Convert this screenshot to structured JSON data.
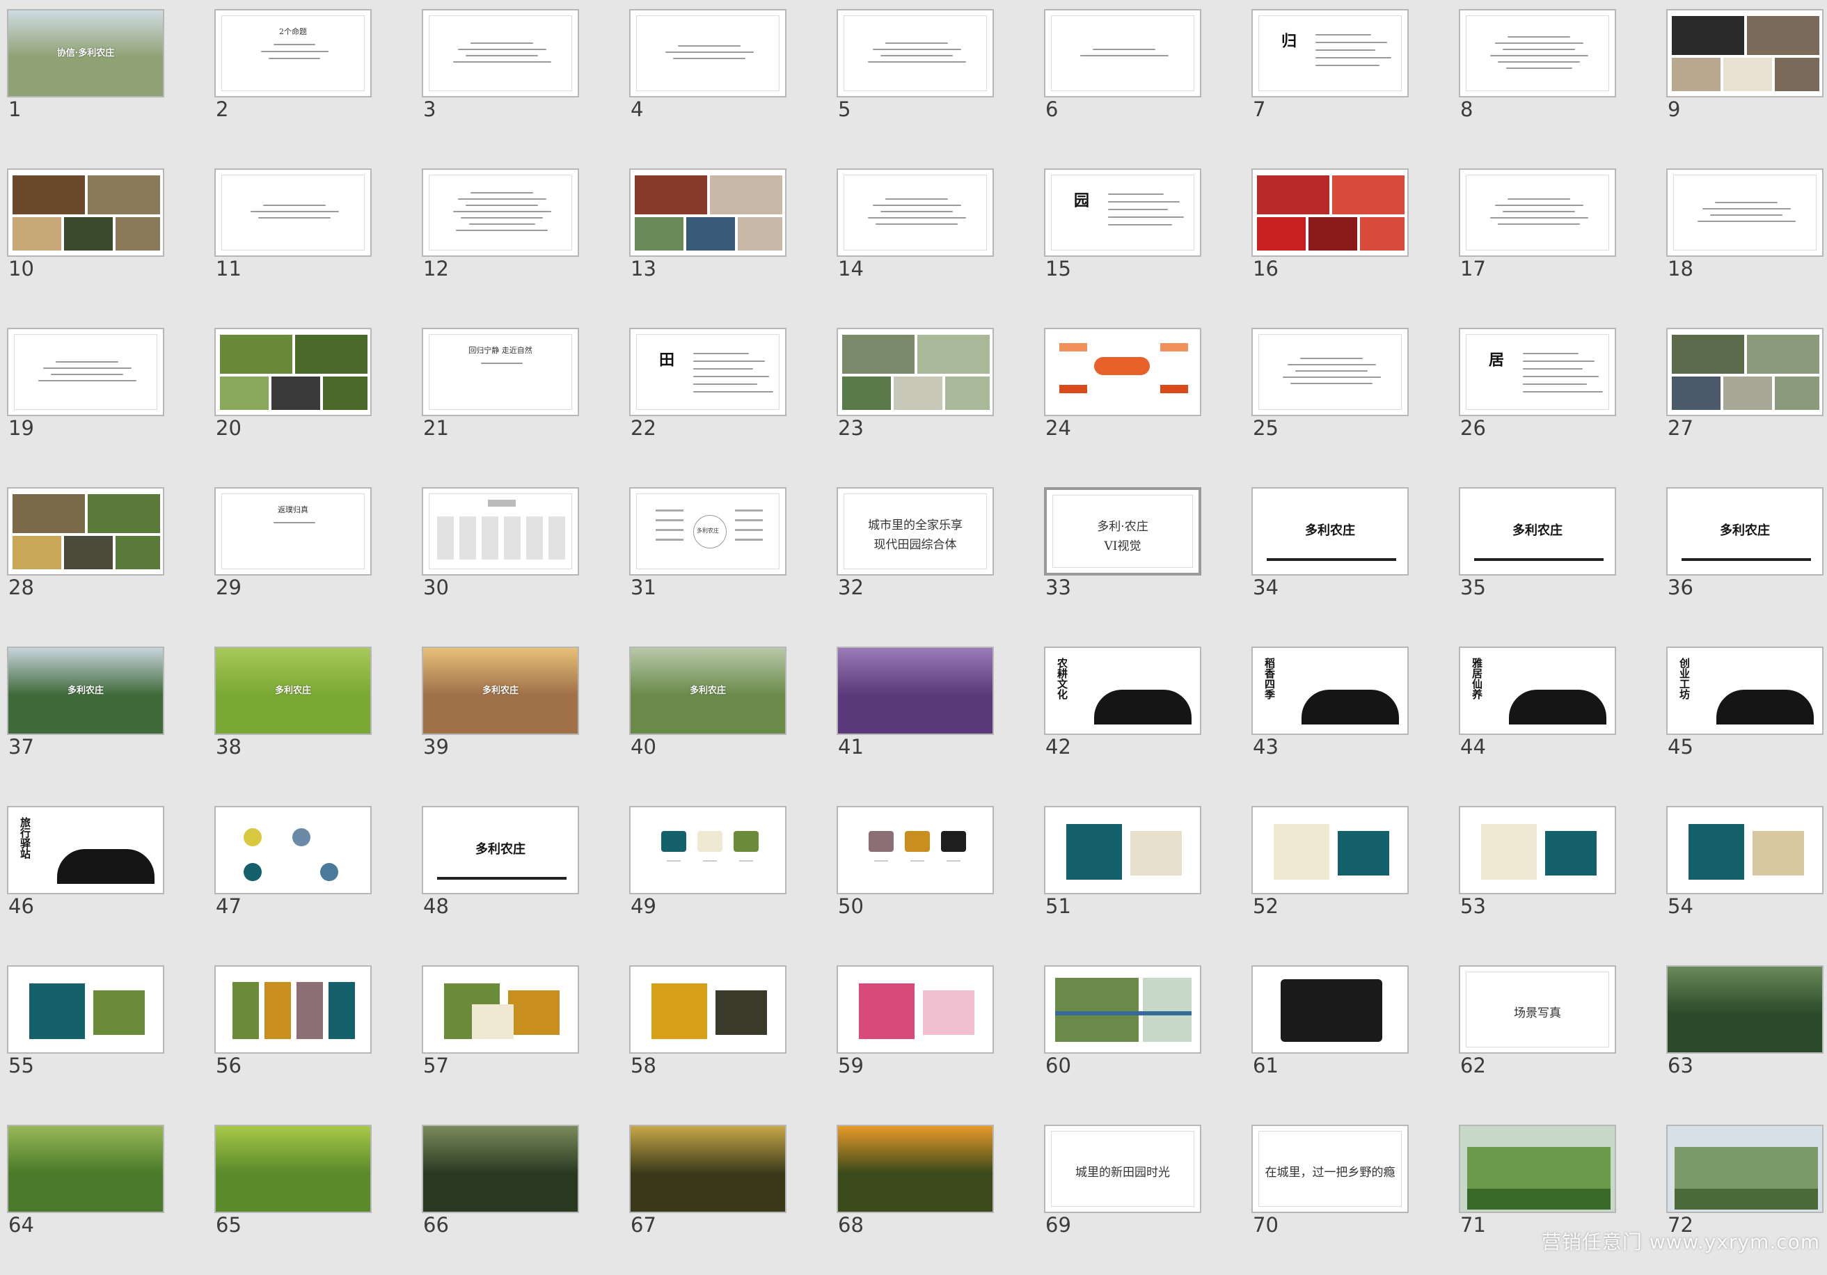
{
  "app": {
    "view": "slide-sorter"
  },
  "colors": {
    "background": "#e6e6e6",
    "thumb_border": "#b7b7b7",
    "selected_border": "#9a9a9a",
    "number_text": "#3c3c3c",
    "brand_teal": "#15616b",
    "brand_cream": "#efe9d4",
    "brand_olive": "#6b8b3a",
    "brand_mauve": "#8c6f74",
    "brand_gold": "#c98f1e",
    "brand_black": "#1e1e1e"
  },
  "selected_slide": "33",
  "watermark": "营销任意门 www.yxrym.com",
  "slides": [
    {
      "n": "1",
      "kind": "photo",
      "bg": "#8fa274",
      "accent": "#cfdbe2",
      "title": "协信·多利农庄"
    },
    {
      "n": "2",
      "kind": "title",
      "title": "2个命题",
      "lines": 3
    },
    {
      "n": "3",
      "kind": "text",
      "lines": 4
    },
    {
      "n": "4",
      "kind": "text",
      "lines": 3
    },
    {
      "n": "5",
      "kind": "text",
      "lines": 4
    },
    {
      "n": "6",
      "kind": "text",
      "lines": 2
    },
    {
      "n": "7",
      "kind": "vchar",
      "char": "归",
      "lines": 5
    },
    {
      "n": "8",
      "kind": "text",
      "lines": 6
    },
    {
      "n": "9",
      "kind": "collage",
      "colors": [
        "#2a2a2a",
        "#7a6a5a",
        "#b8a890",
        "#e8e0d0"
      ]
    },
    {
      "n": "10",
      "kind": "collage",
      "colors": [
        "#6a4a2a",
        "#8a7a5a",
        "#c8a878",
        "#3a4a2a"
      ]
    },
    {
      "n": "11",
      "kind": "text",
      "lines": 3
    },
    {
      "n": "12",
      "kind": "text",
      "lines": 7
    },
    {
      "n": "13",
      "kind": "collage",
      "colors": [
        "#8a3a2a",
        "#c8b8a8",
        "#6a8a5a",
        "#3a5a7a"
      ]
    },
    {
      "n": "14",
      "kind": "text",
      "lines": 5
    },
    {
      "n": "15",
      "kind": "vchar",
      "char": "园",
      "lines": 5
    },
    {
      "n": "16",
      "kind": "collage",
      "colors": [
        "#b82a2a",
        "#d84a3a",
        "#c82020",
        "#8a1a1a"
      ]
    },
    {
      "n": "17",
      "kind": "text",
      "lines": 5
    },
    {
      "n": "18",
      "kind": "text",
      "lines": 4
    },
    {
      "n": "19",
      "kind": "text",
      "lines": 4
    },
    {
      "n": "20",
      "kind": "collage",
      "colors": [
        "#6a8a3a",
        "#4a6a2a",
        "#8aa85a",
        "#3a3a3a"
      ]
    },
    {
      "n": "21",
      "kind": "title",
      "title": "回归宁静 走近自然",
      "lines": 1
    },
    {
      "n": "22",
      "kind": "vchar",
      "char": "田",
      "lines": 6
    },
    {
      "n": "23",
      "kind": "collage",
      "colors": [
        "#7a8a6a",
        "#aab89a",
        "#5a7a4a",
        "#c8c8b8"
      ]
    },
    {
      "n": "24",
      "kind": "diagram",
      "colors": [
        "#e8602a",
        "#f0905a",
        "#d84a1a"
      ]
    },
    {
      "n": "25",
      "kind": "text",
      "lines": 5
    },
    {
      "n": "26",
      "kind": "vchar",
      "char": "居",
      "lines": 6
    },
    {
      "n": "27",
      "kind": "collage",
      "colors": [
        "#5a6a4a",
        "#8a9a7a",
        "#4a5a6a",
        "#a8a898"
      ]
    },
    {
      "n": "28",
      "kind": "collage",
      "colors": [
        "#7a6a4a",
        "#5a7a3a",
        "#c8a858",
        "#4a4a3a"
      ]
    },
    {
      "n": "29",
      "kind": "title",
      "title": "返璞归真",
      "lines": 1
    },
    {
      "n": "30",
      "kind": "orgchart"
    },
    {
      "n": "31",
      "kind": "mindmap",
      "center": "多利农庄"
    },
    {
      "n": "32",
      "kind": "title2",
      "sub": "",
      "l1": "城市里的全家乐享",
      "l2": "现代田园综合体"
    },
    {
      "n": "33",
      "kind": "title2",
      "sub": "",
      "l1": "多利·农庄",
      "l2": "VI视觉"
    },
    {
      "n": "34",
      "kind": "logo",
      "logo": "多利农庄"
    },
    {
      "n": "35",
      "kind": "logo",
      "logo": "多利农庄"
    },
    {
      "n": "36",
      "kind": "logo",
      "logo": "多利农庄"
    },
    {
      "n": "37",
      "kind": "photo",
      "bg": "#3f6a3a",
      "accent": "#c8d4dc",
      "title": "多利农庄"
    },
    {
      "n": "38",
      "kind": "photo",
      "bg": "#7aa834",
      "accent": "#a8c85a",
      "title": "多利农庄"
    },
    {
      "n": "39",
      "kind": "photo",
      "bg": "#a07048",
      "accent": "#e8c078",
      "title": "多利农庄"
    },
    {
      "n": "40",
      "kind": "photo",
      "bg": "#6a8a4a",
      "accent": "#b8c8a8",
      "title": "多利农庄"
    },
    {
      "n": "41",
      "kind": "photo",
      "bg": "#5a3a7a",
      "accent": "#9a7ab8",
      "title": ""
    },
    {
      "n": "42",
      "kind": "ink",
      "char": "农耕文化"
    },
    {
      "n": "43",
      "kind": "ink",
      "char": "稻香四季"
    },
    {
      "n": "44",
      "kind": "ink",
      "char": "雅居仙养"
    },
    {
      "n": "45",
      "kind": "ink",
      "char": "创业工坊"
    },
    {
      "n": "46",
      "kind": "ink",
      "char": "旅行驿站"
    },
    {
      "n": "47",
      "kind": "icons"
    },
    {
      "n": "48",
      "kind": "logo",
      "logo": "多利农庄"
    },
    {
      "n": "49",
      "kind": "swatch",
      "colors": [
        "#15616b",
        "#efe9d4",
        "#6b8b3a"
      ]
    },
    {
      "n": "50",
      "kind": "swatch",
      "colors": [
        "#8c6f74",
        "#c98f1e",
        "#1e1e1e"
      ]
    },
    {
      "n": "51",
      "kind": "mock",
      "colors": [
        "#15616b",
        "#e8e0cc"
      ]
    },
    {
      "n": "52",
      "kind": "mock",
      "colors": [
        "#efe9d4",
        "#15616b"
      ]
    },
    {
      "n": "53",
      "kind": "mock",
      "colors": [
        "#efe9d4",
        "#15616b"
      ]
    },
    {
      "n": "54",
      "kind": "mock",
      "colors": [
        "#15616b",
        "#d8c8a0"
      ]
    },
    {
      "n": "55",
      "kind": "mock",
      "colors": [
        "#15616b",
        "#6b8b3a"
      ]
    },
    {
      "n": "56",
      "kind": "mock",
      "colors": [
        "#6b8b3a",
        "#c98f1e",
        "#8c6f74",
        "#15616b"
      ]
    },
    {
      "n": "57",
      "kind": "mock",
      "colors": [
        "#6b8b3a",
        "#c98f1e",
        "#efe9d4"
      ]
    },
    {
      "n": "58",
      "kind": "mock",
      "colors": [
        "#d8a018",
        "#3a3a2a"
      ]
    },
    {
      "n": "59",
      "kind": "mock",
      "colors": [
        "#d84a7a",
        "#f0c0d0"
      ]
    },
    {
      "n": "60",
      "kind": "map",
      "colors": [
        "#6a8a4a",
        "#c8d8c8",
        "#3a6a9a"
      ]
    },
    {
      "n": "61",
      "kind": "leather",
      "colors": [
        "#1a1a1a"
      ]
    },
    {
      "n": "62",
      "kind": "title2",
      "sub": "",
      "l1": "场景写真",
      "l2": ""
    },
    {
      "n": "63",
      "kind": "photo",
      "bg": "#2a4a2a",
      "accent": "#6a8a5a",
      "title": ""
    },
    {
      "n": "64",
      "kind": "photo",
      "bg": "#4a7a2a",
      "accent": "#98b858",
      "title": ""
    },
    {
      "n": "65",
      "kind": "photo",
      "bg": "#5a8a2a",
      "accent": "#a8c848",
      "title": ""
    },
    {
      "n": "66",
      "kind": "photo",
      "bg": "#2a3a22",
      "accent": "#7a8a5a",
      "title": ""
    },
    {
      "n": "67",
      "kind": "photo",
      "bg": "#3a3a1a",
      "accent": "#c8a848",
      "title": ""
    },
    {
      "n": "68",
      "kind": "photo",
      "bg": "#3a4a1a",
      "accent": "#e89a2a",
      "title": ""
    },
    {
      "n": "69",
      "kind": "title2",
      "sub": "",
      "l1": "城里的新田园时光",
      "l2": ""
    },
    {
      "n": "70",
      "kind": "title2",
      "sub": "",
      "l1": "在城里，过一把乡野的瘾",
      "l2": ""
    },
    {
      "n": "71",
      "kind": "billboard",
      "colors": [
        "#6a9a4a",
        "#c8d8c8",
        "#3a6a2a"
      ]
    },
    {
      "n": "72",
      "kind": "billboard",
      "colors": [
        "#7a9a6a",
        "#d8e0e8",
        "#4a6a3a"
      ]
    }
  ]
}
